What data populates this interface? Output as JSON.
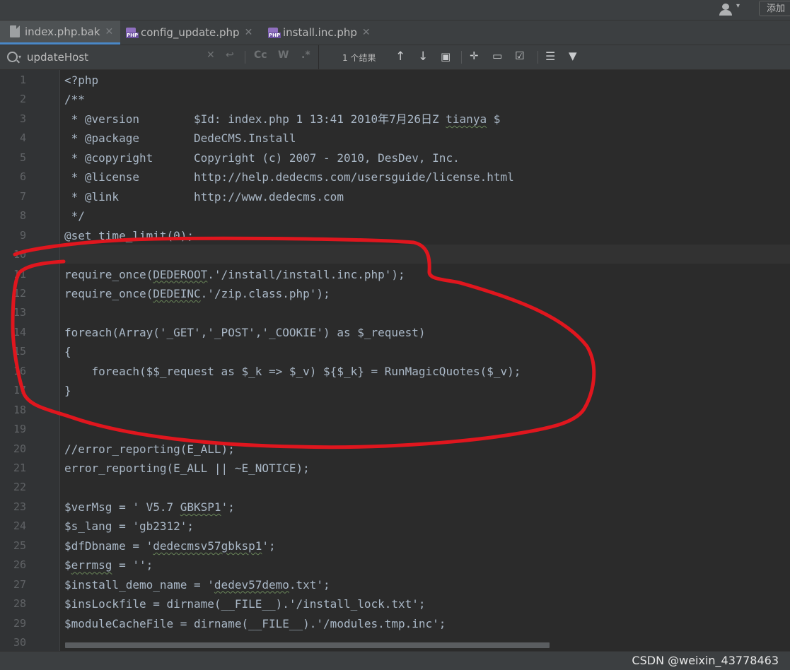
{
  "topbar": {
    "add_button_label": "添加"
  },
  "tabs": [
    {
      "label": "index.php.bak",
      "icon": "file-icon",
      "active": true
    },
    {
      "label": "config_update.php",
      "icon": "php-file-icon",
      "active": false
    },
    {
      "label": "install.inc.php",
      "icon": "php-file-icon",
      "active": false
    }
  ],
  "php_badge": "PHP",
  "find": {
    "query": "updateHost",
    "match_case_label": "Cc",
    "words_label": "W",
    "regex_label": ".*",
    "result_count": "1 个结果"
  },
  "editor": {
    "current_line": 10,
    "line_numbers": [
      "1",
      "2",
      "3",
      "4",
      "5",
      "6",
      "7",
      "8",
      "9",
      "10",
      "11",
      "12",
      "13",
      "14",
      "15",
      "16",
      "17",
      "18",
      "19",
      "20",
      "21",
      "22",
      "23",
      "24",
      "25",
      "26",
      "27",
      "28",
      "29",
      "30"
    ],
    "lines": [
      "<?php",
      "/**",
      " * @version        $Id: index.php 1 13:41 2010年7月26日Z tianya $",
      " * @package        DedeCMS.Install",
      " * @copyright      Copyright (c) 2007 - 2010, DesDev, Inc.",
      " * @license        http://help.dedecms.com/usersguide/license.html",
      " * @link           http://www.dedecms.com",
      " */",
      "@set_time_limit(0);",
      "",
      "require_once(DEDEROOT.'/install/install.inc.php');",
      "require_once(DEDEINC.'/zip.class.php');",
      "",
      "foreach(Array('_GET','_POST','_COOKIE') as $_request)",
      "{",
      "    foreach($$_request as $_k => $_v) ${$_k} = RunMagicQuotes($_v);",
      "}",
      "",
      "",
      "//error_reporting(E_ALL);",
      "error_reporting(E_ALL || ~E_NOTICE);",
      "",
      "$verMsg = ' V5.7 GBKSP1';",
      "$s_lang = 'gb2312';",
      "$dfDbname = 'dedecmsv57gbksp1';",
      "$errmsg = '';",
      "$install_demo_name = 'dedev57demo.txt';",
      "$insLockfile = dirname(__FILE__).'/install_lock.txt';",
      "$moduleCacheFile = dirname(__FILE__).'/modules.tmp.inc';",
      ""
    ]
  },
  "watermark": "CSDN @weixin_43778463",
  "colors": {
    "background": "#2b2b2b",
    "code_text": "#a9b7c6",
    "annotation": "#e0161e",
    "active_tab_underline": "#4a88c7"
  }
}
